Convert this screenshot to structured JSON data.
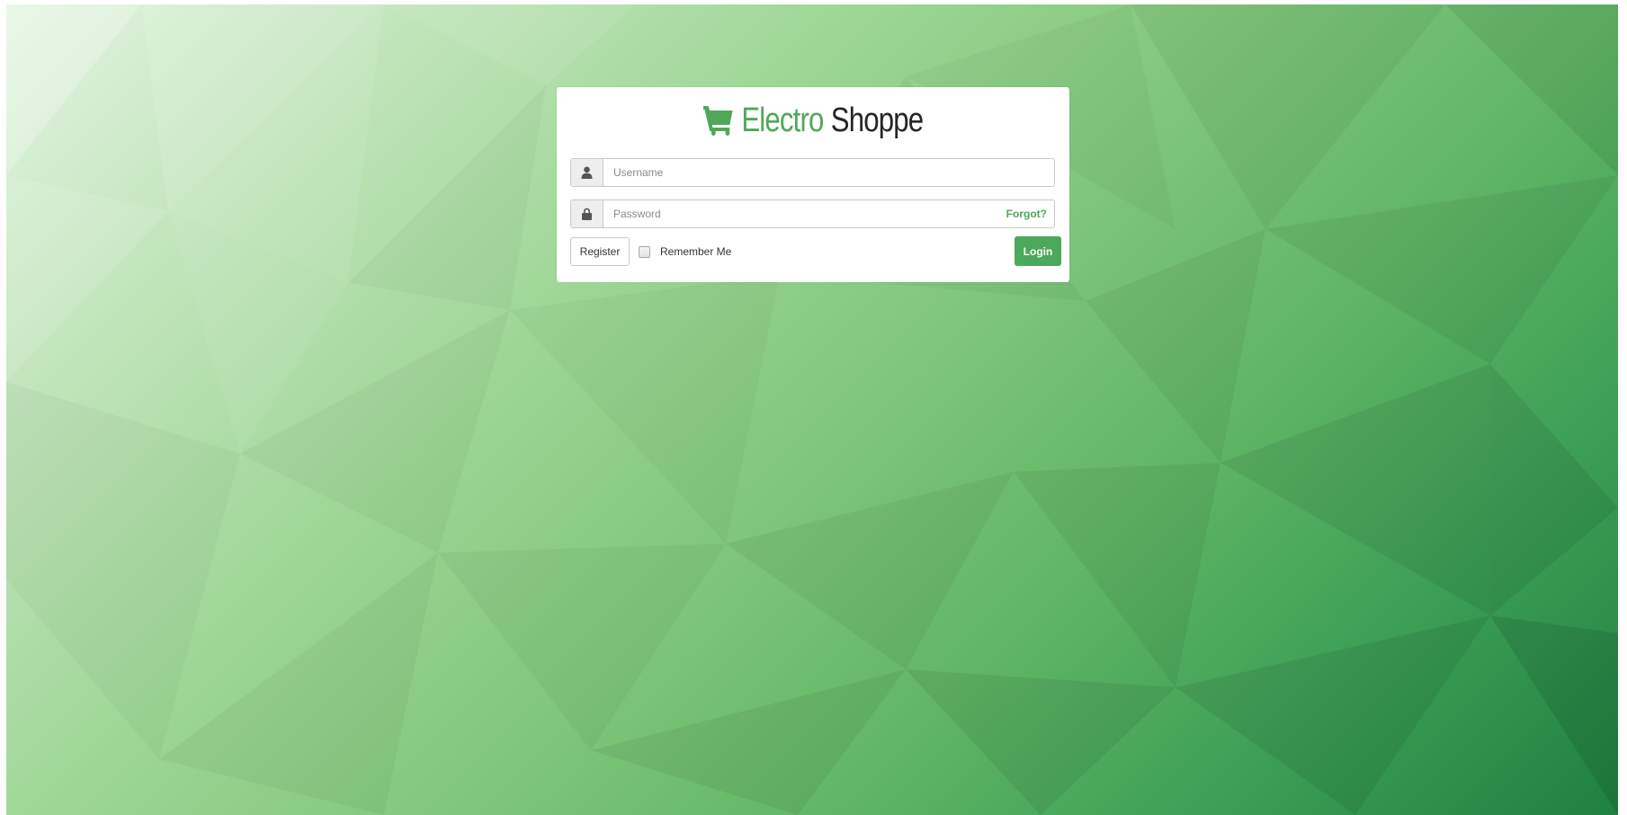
{
  "brand": {
    "icon": "shopping-cart-icon",
    "word1": "Electro",
    "word2": "Shoppe",
    "accent_color": "#4fa85a"
  },
  "form": {
    "username": {
      "icon": "user-icon",
      "placeholder": "Username",
      "value": ""
    },
    "password": {
      "icon": "lock-icon",
      "placeholder": "Password",
      "value": "",
      "forgot_label": "Forgot?"
    },
    "register_label": "Register",
    "remember_label": "Remember Me",
    "remember_checked": false,
    "login_label": "Login"
  },
  "colors": {
    "primary_button": "#4ca85a",
    "background_light": "#e3f4e1",
    "background_dark": "#1f8140"
  }
}
